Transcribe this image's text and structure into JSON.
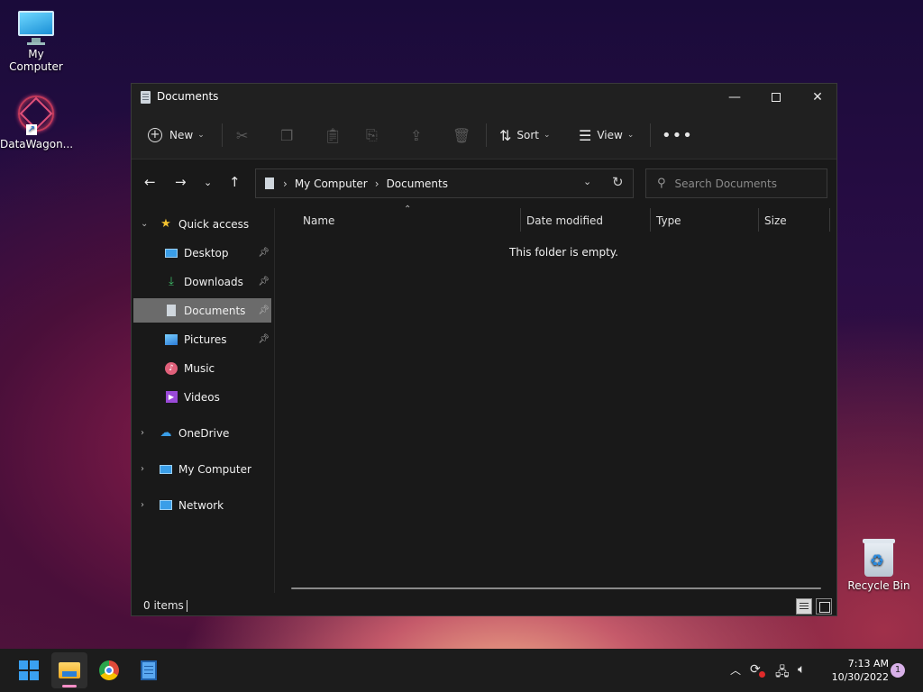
{
  "desktop": {
    "icons": [
      {
        "label": "My Computer"
      },
      {
        "label": "DataWagon..."
      },
      {
        "label": "Recycle Bin"
      }
    ]
  },
  "window": {
    "title": "Documents",
    "toolbar": {
      "new_label": "New",
      "sort_label": "Sort",
      "view_label": "View",
      "more_label": "•••"
    },
    "address": {
      "crumbs": [
        "My Computer",
        "Documents"
      ]
    },
    "search": {
      "placeholder": "Search Documents"
    },
    "sidebar": {
      "quick_access": "Quick access",
      "items": [
        {
          "label": "Desktop",
          "icon": "desktop-icon",
          "pinned": true
        },
        {
          "label": "Downloads",
          "icon": "download-icon",
          "pinned": true
        },
        {
          "label": "Documents",
          "icon": "document-icon",
          "pinned": true,
          "selected": true
        },
        {
          "label": "Pictures",
          "icon": "pictures-icon",
          "pinned": true
        },
        {
          "label": "Music",
          "icon": "music-icon",
          "pinned": false
        },
        {
          "label": "Videos",
          "icon": "videos-icon",
          "pinned": false
        }
      ],
      "onedrive": "OneDrive",
      "mycomputer": "My Computer",
      "network": "Network"
    },
    "columns": {
      "name": "Name",
      "date": "Date modified",
      "type": "Type",
      "size": "Size"
    },
    "empty_message": "This folder is empty.",
    "status": {
      "items": "0 items"
    }
  },
  "taskbar": {
    "clock_time": "7:13 AM",
    "clock_date": "10/30/2022",
    "notifications": "1"
  },
  "colors": {
    "accent": "#3aa0f0",
    "selection": "#6b6b6b",
    "window_bg": "#191919"
  }
}
